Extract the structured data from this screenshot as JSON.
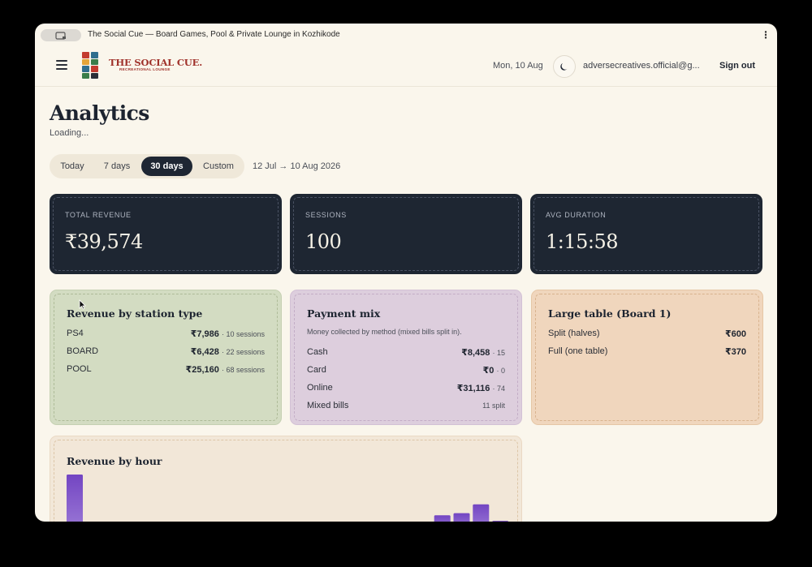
{
  "window": {
    "title": "The Social Cue — Board Games, Pool & Private Lounge in Kozhikode"
  },
  "header": {
    "logo_main": "THE SOCIAL CUE.",
    "logo_sub": "RECREATIONAL LOUNGE",
    "date": "Mon, 10 Aug",
    "email": "adversecreatives.official@g...",
    "signout_label": "Sign out"
  },
  "page": {
    "title": "Analytics",
    "status": "Loading..."
  },
  "range": {
    "options": [
      "Today",
      "7 days",
      "30 days",
      "Custom"
    ],
    "selected": "30 days",
    "text": "12 Jul → 10 Aug 2026"
  },
  "kpis": [
    {
      "label": "TOTAL REVENUE",
      "value": "₹39,574"
    },
    {
      "label": "SESSIONS",
      "value": "100"
    },
    {
      "label": "AVG DURATION",
      "value": "1:15:58"
    }
  ],
  "station": {
    "title": "Revenue by station type",
    "rows": [
      {
        "label": "PS4",
        "value": "₹7,986",
        "sub": "· 10 sessions"
      },
      {
        "label": "BOARD",
        "value": "₹6,428",
        "sub": "· 22 sessions"
      },
      {
        "label": "POOL",
        "value": "₹25,160",
        "sub": "· 68 sessions"
      }
    ]
  },
  "payment": {
    "title": "Payment mix",
    "note": "Money collected by method (mixed bills split in).",
    "rows": [
      {
        "label": "Cash",
        "value": "₹8,458",
        "sub": "· 15"
      },
      {
        "label": "Card",
        "value": "₹0",
        "sub": "· 0"
      },
      {
        "label": "Online",
        "value": "₹31,116",
        "sub": "· 74"
      },
      {
        "label": "Mixed bills",
        "value": "",
        "sub": "11 split"
      }
    ]
  },
  "large_table": {
    "title": "Large table (Board 1)",
    "rows": [
      {
        "label": "Split (halves)",
        "value": "₹600"
      },
      {
        "label": "Full (one table)",
        "value": "₹370"
      }
    ]
  },
  "hour_chart": {
    "title": "Revenue by hour"
  },
  "chart_data": {
    "type": "bar",
    "title": "Revenue by hour",
    "xlabel": "",
    "ylabel": "",
    "values": [
      100,
      0,
      0,
      0,
      0,
      0,
      0,
      0,
      0,
      0,
      0,
      0,
      0,
      0,
      0,
      0,
      0,
      0,
      3,
      26,
      30,
      46,
      16
    ],
    "ylim": [
      0,
      100
    ],
    "grid": false,
    "color": "#7b4fc4"
  },
  "colors": {
    "dark": "#1e2632",
    "accent": "#7b4fc4"
  }
}
